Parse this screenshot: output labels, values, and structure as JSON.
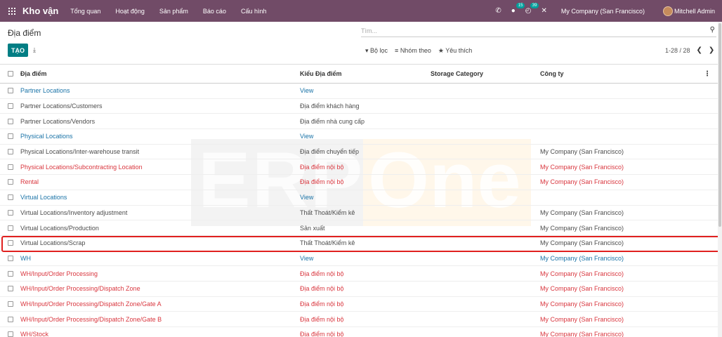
{
  "topbar": {
    "app_name": "Kho vận",
    "menu": [
      "Tổng quan",
      "Hoạt động",
      "Sản phẩm",
      "Báo cáo",
      "Cấu hình"
    ],
    "messages_count": "15",
    "activities_count": "39",
    "company": "My Company (San Francisco)",
    "user": "Mitchell Admin",
    "icons": [
      "apps-icon",
      "phone-icon",
      "chat-icon",
      "clock-icon",
      "close-icon"
    ],
    "bg_color": "#714b67"
  },
  "control_panel": {
    "breadcrumb": "Địa điểm",
    "search_placeholder": "Tìm...",
    "create_label": "TẠO",
    "filters_label": "Bộ lọc",
    "group_label": "Nhóm theo",
    "favorites_label": "Yêu thích",
    "pager": "1-28 / 28"
  },
  "watermark": {
    "left": "ERP",
    "right": "One"
  },
  "table": {
    "headers": [
      "Địa điểm",
      "Kiểu Địa điểm",
      "Storage Category",
      "Công ty"
    ],
    "rows": [
      {
        "name": "Partner Locations",
        "type": "View",
        "storage": "",
        "company": "",
        "color": "blue"
      },
      {
        "name": "Partner Locations/Customers",
        "type": "Địa điểm khách hàng",
        "storage": "",
        "company": "",
        "color": "dark"
      },
      {
        "name": "Partner Locations/Vendors",
        "type": "Địa điểm nhà cung cấp",
        "storage": "",
        "company": "",
        "color": "dark"
      },
      {
        "name": "Physical Locations",
        "type": "View",
        "storage": "",
        "company": "",
        "color": "blue"
      },
      {
        "name": "Physical Locations/Inter-warehouse transit",
        "type": "Địa điểm chuyển tiếp",
        "storage": "",
        "company": "My Company (San Francisco)",
        "color": "dark"
      },
      {
        "name": "Physical Locations/Subcontracting Location",
        "type": "Địa điểm nội bộ",
        "storage": "",
        "company": "My Company (San Francisco)",
        "color": "red"
      },
      {
        "name": "Rental",
        "type": "Địa điểm nội bộ",
        "storage": "",
        "company": "My Company (San Francisco)",
        "color": "red"
      },
      {
        "name": "Virtual Locations",
        "type": "View",
        "storage": "",
        "company": "",
        "color": "blue"
      },
      {
        "name": "Virtual Locations/Inventory adjustment",
        "type": "Thất Thoát/Kiểm kê",
        "storage": "",
        "company": "My Company (San Francisco)",
        "color": "dark"
      },
      {
        "name": "Virtual Locations/Production",
        "type": "Sản xuất",
        "storage": "",
        "company": "My Company (San Francisco)",
        "color": "dark"
      },
      {
        "name": "Virtual Locations/Scrap",
        "type": "Thất Thoát/Kiểm kê",
        "storage": "",
        "company": "My Company (San Francisco)",
        "color": "dark"
      },
      {
        "name": "WH",
        "type": "View",
        "storage": "",
        "company": "My Company (San Francisco)",
        "color": "blue"
      },
      {
        "name": "WH/Input/Order Processing",
        "type": "Địa điểm nội bộ",
        "storage": "",
        "company": "My Company (San Francisco)",
        "color": "red"
      },
      {
        "name": "WH/Input/Order Processing/Dispatch Zone",
        "type": "Địa điểm nội bộ",
        "storage": "",
        "company": "My Company (San Francisco)",
        "color": "red"
      },
      {
        "name": "WH/Input/Order Processing/Dispatch Zone/Gate A",
        "type": "Địa điểm nội bộ",
        "storage": "",
        "company": "My Company (San Francisco)",
        "color": "red"
      },
      {
        "name": "WH/Input/Order Processing/Dispatch Zone/Gate B",
        "type": "Địa điểm nội bộ",
        "storage": "",
        "company": "My Company (San Francisco)",
        "color": "red"
      },
      {
        "name": "WH/Stock",
        "type": "Địa điểm nội bộ",
        "storage": "",
        "company": "My Company (San Francisco)",
        "color": "red"
      }
    ],
    "highlighted_row": "Virtual Locations/Scrap"
  }
}
